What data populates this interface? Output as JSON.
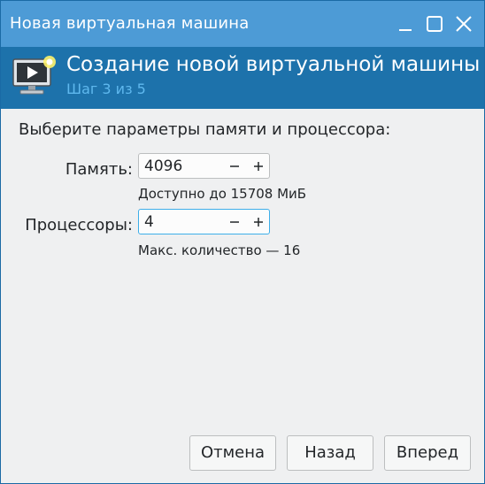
{
  "window": {
    "title": "Новая виртуальная машина"
  },
  "header": {
    "title": "Создание новой виртуальной машины",
    "step": "Шаг 3 из 5",
    "icon": "virtual-machine-icon"
  },
  "content": {
    "prompt": "Выберите параметры памяти и процессора:",
    "memory": {
      "label": "Память:",
      "value": "4096",
      "hint": "Доступно до 15708 МиБ"
    },
    "cpus": {
      "label": "Процессоры:",
      "value": "4",
      "hint": "Макс. количество — 16"
    }
  },
  "buttons": {
    "cancel": "Отмена",
    "back": "Назад",
    "next": "Вперед"
  },
  "colors": {
    "titlebar": "#4d9bd6",
    "header": "#1d72ab",
    "step_text": "#5fb8ee",
    "focus": "#3daee9"
  }
}
